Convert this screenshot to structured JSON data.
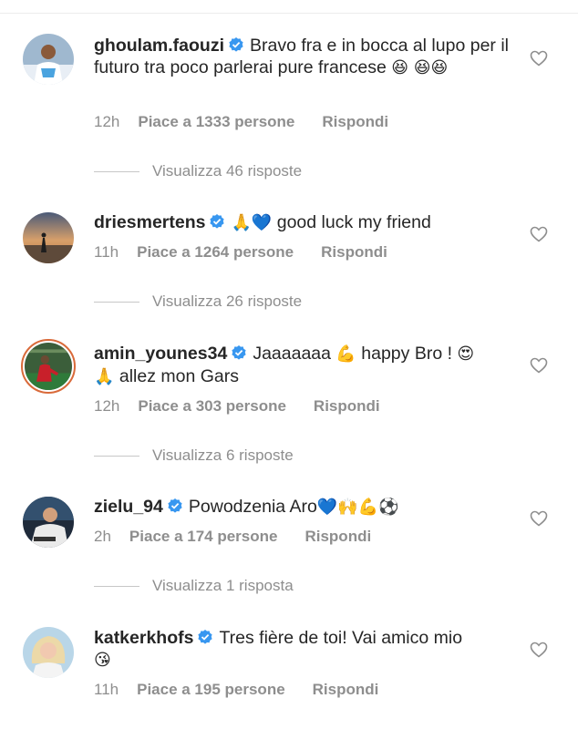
{
  "comments": [
    {
      "username": "ghoulam.faouzi",
      "text": "Bravo fra e in bocca al lupo per il futuro tra poco parlerai pure francese",
      "emoji": "😆 😆😆",
      "time": "12h",
      "likes": "Piace a 1333 persone",
      "reply": "Rispondi",
      "replies": "Visualizza 46 risposte"
    },
    {
      "username": "driesmertens",
      "text": "good luck my friend",
      "emoji_pre": "🙏💙",
      "time": "11h",
      "likes": "Piace a 1264 persone",
      "reply": "Rispondi",
      "replies": "Visualizza 26 risposte"
    },
    {
      "username": "amin_younes34",
      "text_a": "Jaaaaaaa",
      "emoji_a": "💪",
      "text_b": "happy Bro !",
      "emoji_b": "😍",
      "emoji_c": "🙏",
      "text_c": "allez mon Gars",
      "time": "12h",
      "likes": "Piace a 303 persone",
      "reply": "Rispondi",
      "replies": "Visualizza 6 risposte"
    },
    {
      "username": "zielu_94",
      "text": "Powodzenia Aro",
      "emoji": "💙🙌💪⚽",
      "time": "2h",
      "likes": "Piace a 174 persone",
      "reply": "Rispondi",
      "replies": "Visualizza 1 risposta"
    },
    {
      "username": "katkerkhofs",
      "text": "Tres fière de toi! Vai amico mio",
      "emoji": "😘",
      "time": "11h",
      "likes": "Piace a 195 persone",
      "reply": "Rispondi"
    }
  ],
  "icons": {
    "verified": "verified-badge-icon",
    "like": "heart-outline-icon"
  },
  "colors": {
    "verified": "#3897f0",
    "meta_text": "#8e8e8e",
    "story_ring": "#d96a3a"
  }
}
